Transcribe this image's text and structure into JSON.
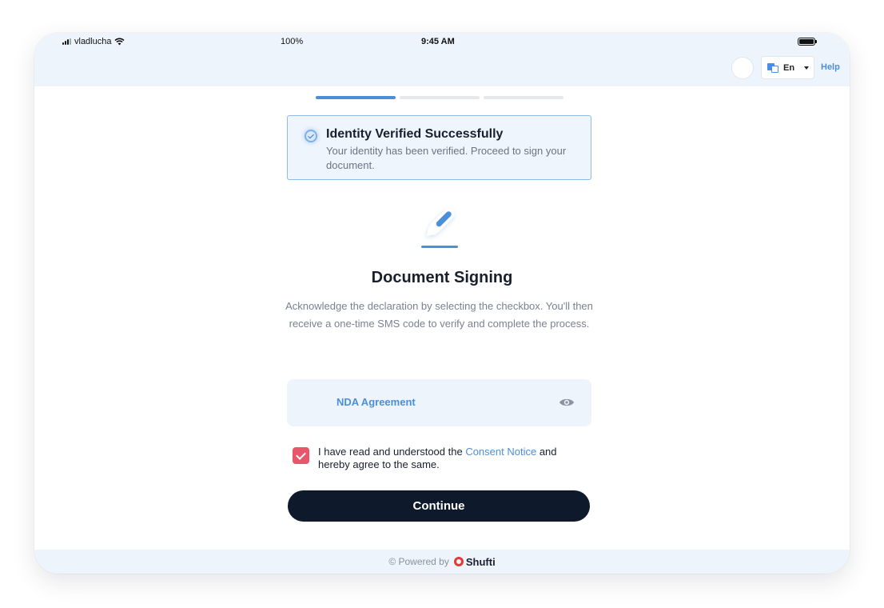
{
  "status_bar": {
    "carrier": "vladlucha",
    "battery_percent": "100%",
    "time": "9:45 AM"
  },
  "header": {
    "language": "En",
    "help_label": "Help"
  },
  "progress": {
    "steps_total": 3,
    "current_step": 1
  },
  "alert": {
    "title": "Identity Verified Successfully",
    "message": "Your identity has been verified. Proceed to sign your document."
  },
  "main": {
    "icon": "pen-icon",
    "title": "Document Signing",
    "description": "Acknowledge the declaration by selecting the checkbox. You'll then receive a one-time SMS code to verify and complete the process."
  },
  "document": {
    "name": "NDA Agreement",
    "view_icon": "eye-icon"
  },
  "consent": {
    "checked": true,
    "text_before": "I have read and understood the ",
    "link_text": "Consent Notice",
    "text_after": " and hereby agree to the same."
  },
  "actions": {
    "continue_label": "Continue"
  },
  "footer": {
    "powered_by": "© Powered by",
    "brand": "Shufti"
  },
  "colors": {
    "accent": "#4a90d9",
    "checkbox": "#e8566b",
    "button": "#0e1a2b",
    "panel": "#eef4fc"
  }
}
